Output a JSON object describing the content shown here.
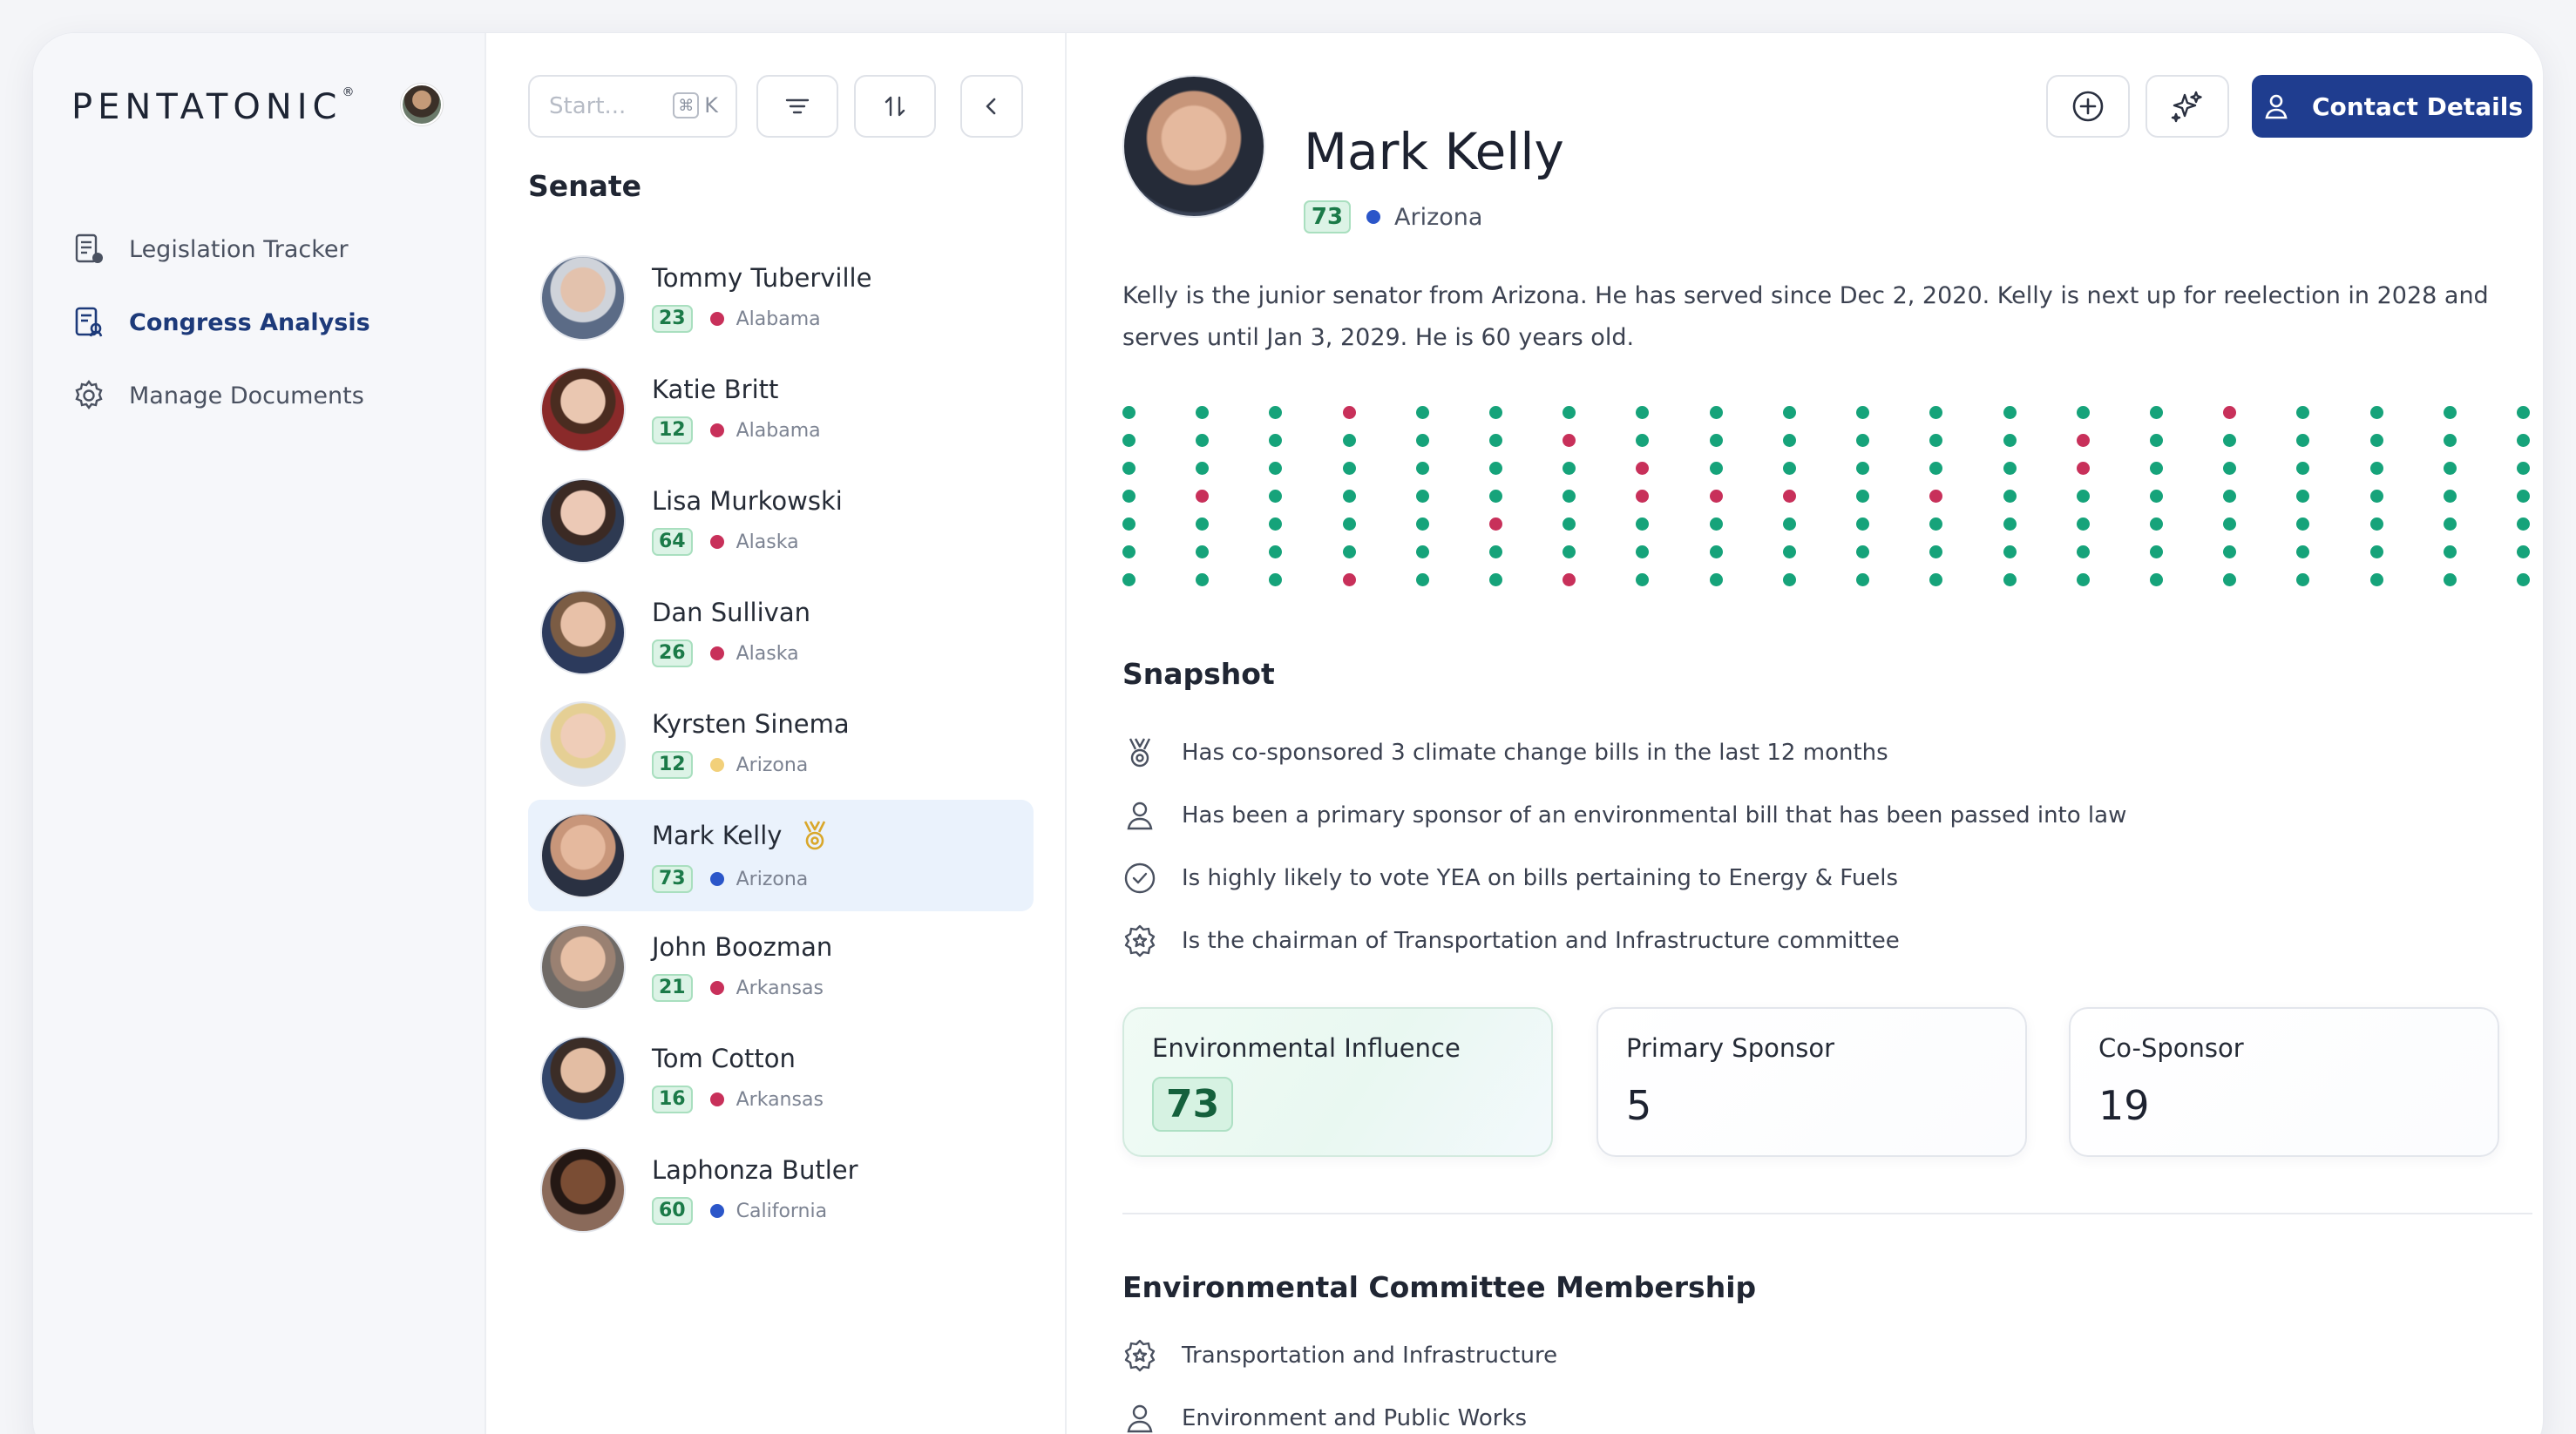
{
  "app": {
    "logo": "PENTATONIC",
    "logo_mark": "®"
  },
  "sidebar": {
    "items": [
      {
        "label": "Legislation Tracker",
        "icon": "document-list-icon",
        "active": false
      },
      {
        "label": "Congress Analysis",
        "icon": "document-chart-icon",
        "active": true
      },
      {
        "label": "Manage Documents",
        "icon": "gear-icon",
        "active": false
      }
    ]
  },
  "list": {
    "search_placeholder": "Start...",
    "shortcut": "K",
    "title": "Senate",
    "people": [
      {
        "name": "Tommy Tuberville",
        "score": "23",
        "state": "Alabama",
        "party_color": "#c8305a",
        "active": false
      },
      {
        "name": "Katie Britt",
        "score": "12",
        "state": "Alabama",
        "party_color": "#c8305a",
        "active": false
      },
      {
        "name": "Lisa Murkowski",
        "score": "64",
        "state": "Alaska",
        "party_color": "#c8305a",
        "active": false
      },
      {
        "name": "Dan Sullivan",
        "score": "26",
        "state": "Alaska",
        "party_color": "#c8305a",
        "active": false
      },
      {
        "name": "Kyrsten Sinema",
        "score": "12",
        "state": "Arizona",
        "party_color": "#f2d07a",
        "active": false
      },
      {
        "name": "Mark Kelly",
        "score": "73",
        "state": "Arizona",
        "party_color": "#2b56c9",
        "active": true
      },
      {
        "name": "John Boozman",
        "score": "21",
        "state": "Arkansas",
        "party_color": "#c8305a",
        "active": false
      },
      {
        "name": "Tom Cotton",
        "score": "16",
        "state": "Arkansas",
        "party_color": "#c8305a",
        "active": false
      },
      {
        "name": "Laphonza Butler",
        "score": "60",
        "state": "California",
        "party_color": "#2b56c9",
        "active": false
      }
    ]
  },
  "detail": {
    "name": "Mark Kelly",
    "score": "73",
    "state": "Arizona",
    "party_color": "#2b56c9",
    "contact_label": "Contact Details",
    "bio": "Kelly is the junior senator from Arizona. He has served since Dec 2, 2020. Kelly is next up for reelection in 2028 and serves until Jan 3, 2029. He is 60 years old.",
    "vote_colors": {
      "yea": "#16a37a",
      "nay": "#c8305a",
      "none": "#dce3ee"
    },
    "votes": [
      "GGGGGGG",
      "GGGNGGG",
      "GGGGGGG",
      "NGGGGGN",
      "GGGGGGG",
      "GGGGNGG",
      "GNGGGGN",
      "GGNNGGG",
      "GGGNGGG",
      "GGGNGGG",
      "GGGGGGG",
      "GGGNGGG",
      "GGGGGGG",
      "GNNGGGG",
      "GGGGGGG",
      "NGGGGGG",
      "GGGGGGG",
      "GGGGGGG",
      "GGGGGGG",
      "GGGGGGG"
    ],
    "snapshot_title": "Snapshot",
    "facts": [
      {
        "icon": "medal-icon",
        "text": "Has co-sponsored 3 climate change bills in the last 12 months"
      },
      {
        "icon": "person-icon",
        "text": "Has been a primary sponsor of an environmental bill that has been passed into law"
      },
      {
        "icon": "check-circle-icon",
        "text": "Is highly likely to vote YEA on bills pertaining to Energy & Fuels"
      },
      {
        "icon": "star-badge-icon",
        "text": "Is the chairman of Transportation and Infrastructure committee"
      }
    ],
    "cards": [
      {
        "label": "Environmental Influence",
        "value": "73"
      },
      {
        "label": "Primary Sponsor",
        "value": "5"
      },
      {
        "label": "Co-Sponsor",
        "value": "19"
      }
    ],
    "committee_title": "Environmental Committee Membership",
    "committees": [
      {
        "icon": "star-badge-icon",
        "text": "Transportation and Infrastructure"
      },
      {
        "icon": "person-icon",
        "text": "Environment and Public Works"
      }
    ]
  }
}
